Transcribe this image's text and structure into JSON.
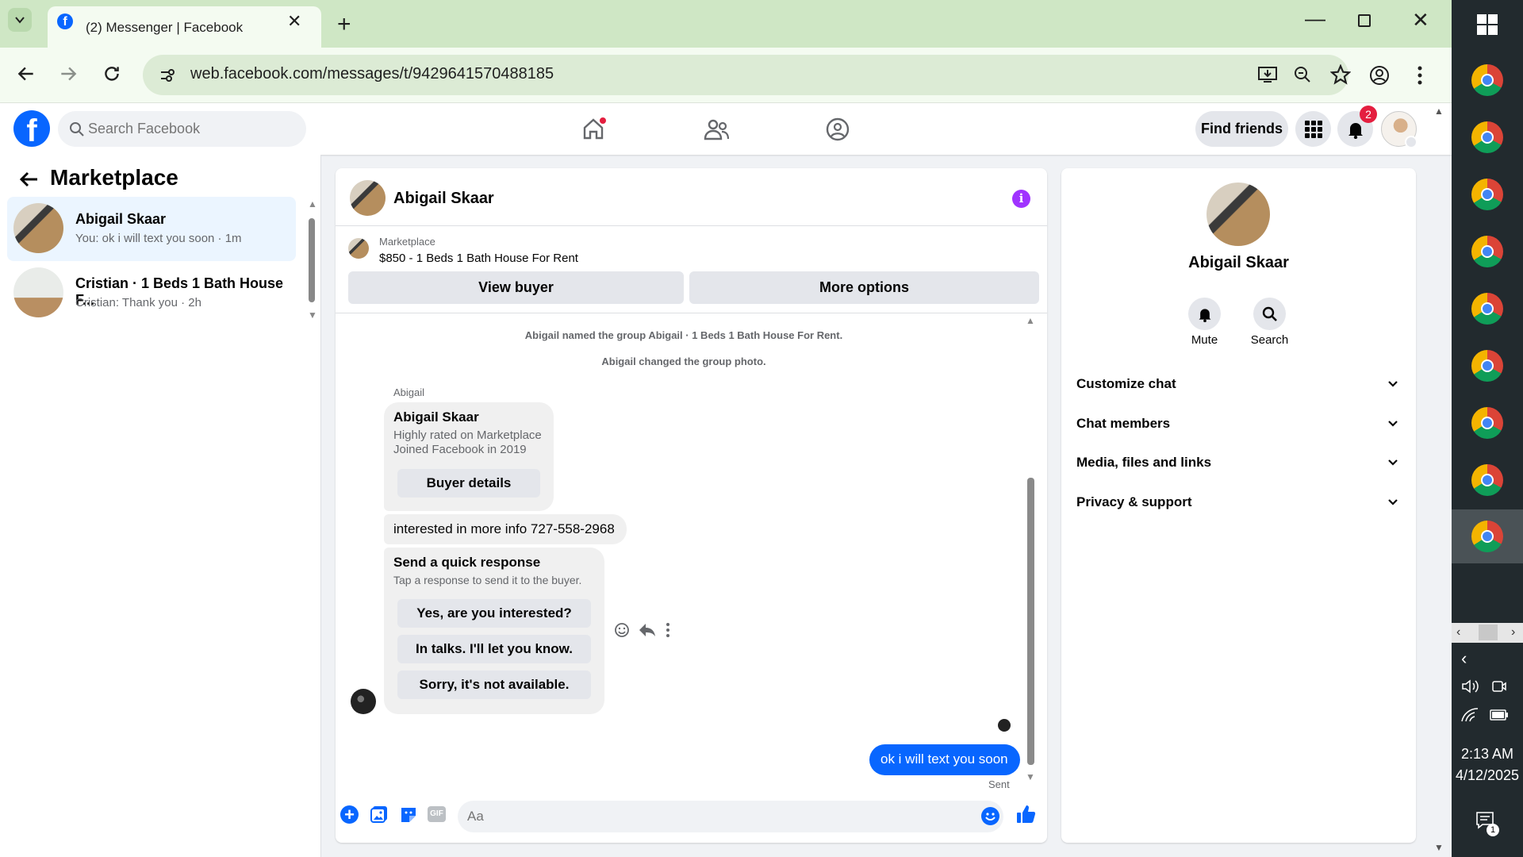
{
  "browser": {
    "tab_title": "(2) Messenger | Facebook",
    "url": "web.facebook.com/messages/t/9429641570488185"
  },
  "header": {
    "search_placeholder": "Search Facebook",
    "find_friends": "Find friends",
    "notification_count": "2"
  },
  "sidebar": {
    "title": "Marketplace",
    "chats": [
      {
        "name": "Abigail Skaar",
        "preview": "You: ok i will text you soon · 1m"
      },
      {
        "name": "Cristian · 1 Beds 1 Bath House F...",
        "preview": "Cristian: Thank you · 2h"
      }
    ]
  },
  "chat": {
    "name": "Abigail Skaar",
    "listing_label": "Marketplace",
    "listing_title": "$850 - 1 Beds 1 Bath House For Rent",
    "view_buyer": "View buyer",
    "more_options": "More options",
    "events": [
      "Abigail named the group Abigail · 1 Beds 1 Bath House For Rent.",
      "Abigail changed the group photo."
    ],
    "sender_label": "Abigail",
    "buyer_card": {
      "name": "Abigail Skaar",
      "line1": "Highly rated on Marketplace",
      "line2": "Joined Facebook in 2019",
      "button": "Buyer details"
    },
    "incoming_message": "interested in more info 727-558-2968",
    "quick": {
      "title": "Send a quick response",
      "subtitle": "Tap a response to send it to the buyer.",
      "options": [
        "Yes, are you interested?",
        "In talks. I'll let you know.",
        "Sorry, it's not available."
      ]
    },
    "outgoing_message": "ok i will text you soon",
    "status": "Sent",
    "composer_placeholder": "Aa"
  },
  "info_panel": {
    "name": "Abigail Skaar",
    "mute": "Mute",
    "search": "Search",
    "sections": [
      "Customize chat",
      "Chat members",
      "Media, files and links",
      "Privacy & support"
    ]
  },
  "taskbar": {
    "time": "2:13 AM",
    "date": "4/12/2025",
    "notif_count": "1"
  },
  "colors": {
    "facebook_blue": "#0866ff",
    "messenger_purple": "#a033ff",
    "notification_red": "#e41e3f"
  }
}
